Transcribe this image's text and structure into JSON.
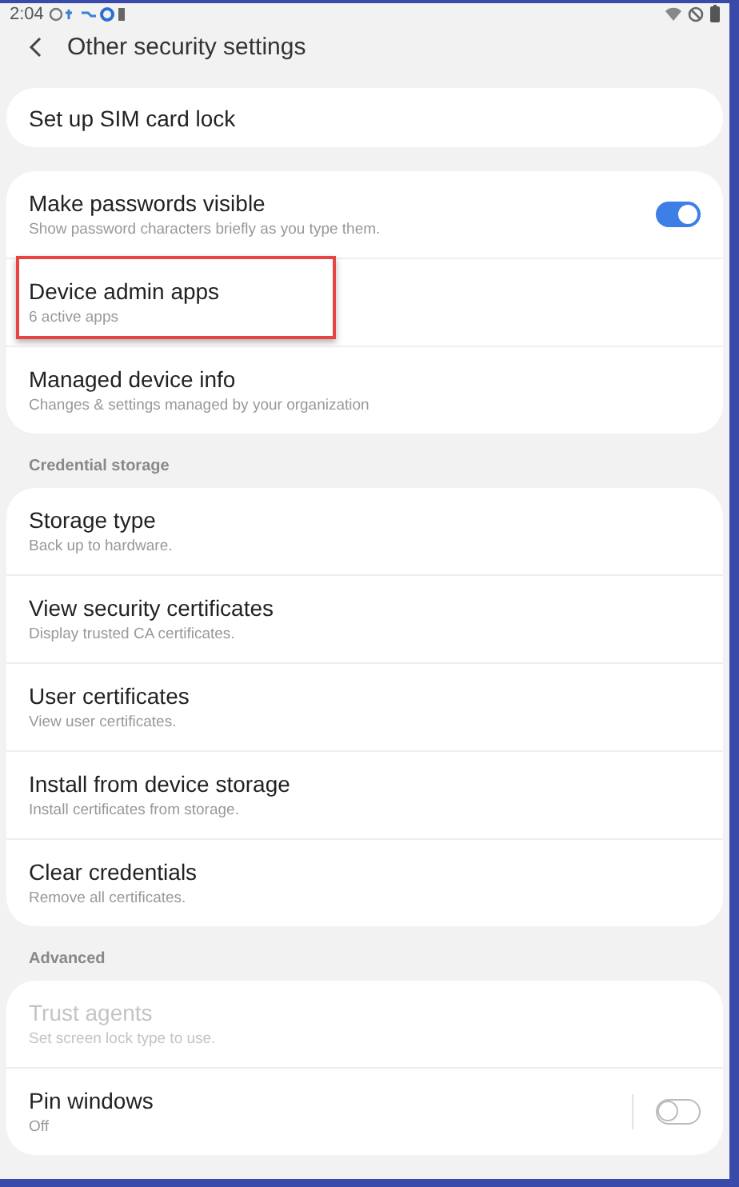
{
  "status_bar": {
    "time": "2:04"
  },
  "header": {
    "title": "Other security settings"
  },
  "groups": [
    {
      "items": [
        {
          "title": "Set up SIM card lock",
          "disabled": false,
          "highlighted": false
        }
      ]
    },
    {
      "items": [
        {
          "title": "Make passwords visible",
          "subtitle": "Show password characters briefly as you type them.",
          "disabled": false,
          "highlighted": false,
          "switch": {
            "on": true,
            "divider": false
          }
        },
        {
          "title": "Device admin apps",
          "subtitle": "6 active apps",
          "disabled": false,
          "highlighted": true
        },
        {
          "title": "Managed device info",
          "subtitle": "Changes & settings managed by your organization",
          "disabled": false,
          "highlighted": false
        }
      ]
    },
    {
      "label": "Credential storage",
      "items": [
        {
          "title": "Storage type",
          "subtitle": "Back up to hardware.",
          "disabled": false,
          "highlighted": false
        },
        {
          "title": "View security certificates",
          "subtitle": "Display trusted CA certificates.",
          "disabled": false,
          "highlighted": false
        },
        {
          "title": "User certificates",
          "subtitle": "View user certificates.",
          "disabled": false,
          "highlighted": false
        },
        {
          "title": "Install from device storage",
          "subtitle": "Install certificates from storage.",
          "disabled": false,
          "highlighted": false
        },
        {
          "title": "Clear credentials",
          "subtitle": "Remove all certificates.",
          "disabled": false,
          "highlighted": false
        }
      ]
    },
    {
      "label": "Advanced",
      "items": [
        {
          "title": "Trust agents",
          "subtitle": "Set screen lock type to use.",
          "disabled": true,
          "highlighted": false
        },
        {
          "title": "Pin windows",
          "subtitle": "Off",
          "disabled": false,
          "highlighted": false,
          "switch": {
            "on": false,
            "divider": true
          }
        }
      ]
    }
  ]
}
